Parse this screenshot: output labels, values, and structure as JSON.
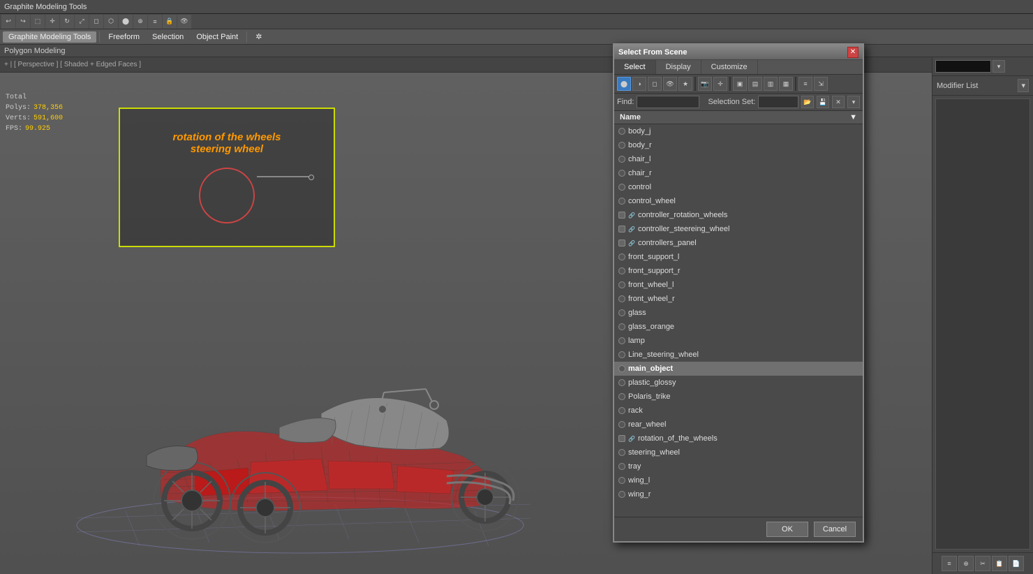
{
  "app": {
    "title": "Graphite Modeling Tools",
    "menu_items": [
      "Freeform",
      "Selection",
      "Object Paint",
      ""
    ],
    "sub_bar": "Polygon Modeling"
  },
  "viewport": {
    "label": "+ | [ Perspective ] [ Shaded + Edged Faces ]",
    "stats": {
      "polys_label": "Polys:",
      "polys_value": "378,356",
      "verts_label": "Verts:",
      "verts_value": "591,600",
      "fps_label": "FPS:",
      "fps_value": "99.925",
      "total_label": "Total"
    },
    "anim_text1": "rotation of the wheels",
    "anim_text2": "steering wheel"
  },
  "right_panel": {
    "modifier_label": "Modifier List",
    "buttons": [
      "≡",
      "🔗",
      "✂",
      "📋",
      "📄"
    ]
  },
  "dialog": {
    "title": "Select From Scene",
    "close": "✕",
    "tabs": [
      "Select",
      "Display",
      "Customize"
    ],
    "active_tab": "Select",
    "find_label": "Find:",
    "find_placeholder": "",
    "sel_set_label": "Selection Set:",
    "name_column": "Name",
    "objects": [
      {
        "name": "body_j",
        "type": "mesh",
        "selected": false
      },
      {
        "name": "body_r",
        "type": "mesh",
        "selected": false
      },
      {
        "name": "chair_l",
        "type": "mesh",
        "selected": false
      },
      {
        "name": "chair_r",
        "type": "mesh",
        "selected": false
      },
      {
        "name": "control",
        "type": "mesh",
        "selected": false
      },
      {
        "name": "control_wheel",
        "type": "mesh",
        "selected": false
      },
      {
        "name": "controller_rotation_wheels",
        "type": "linked",
        "selected": false
      },
      {
        "name": "controller_steereing_wheel",
        "type": "linked",
        "selected": false
      },
      {
        "name": "controllers_panel",
        "type": "linked",
        "selected": false
      },
      {
        "name": "front_support_l",
        "type": "mesh",
        "selected": false
      },
      {
        "name": "front_support_r",
        "type": "mesh",
        "selected": false
      },
      {
        "name": "front_wheel_l",
        "type": "mesh",
        "selected": false
      },
      {
        "name": "front_wheel_r",
        "type": "mesh",
        "selected": false
      },
      {
        "name": "glass",
        "type": "mesh",
        "selected": false
      },
      {
        "name": "glass_orange",
        "type": "mesh",
        "selected": false
      },
      {
        "name": "lamp",
        "type": "mesh",
        "selected": false
      },
      {
        "name": "Line_steering_wheel",
        "type": "mesh",
        "selected": false
      },
      {
        "name": "main_object",
        "type": "mesh",
        "selected": true
      },
      {
        "name": "plastic_glossy",
        "type": "mesh",
        "selected": false
      },
      {
        "name": "Polaris_trike",
        "type": "mesh",
        "selected": false
      },
      {
        "name": "rack",
        "type": "mesh",
        "selected": false
      },
      {
        "name": "rear_wheel",
        "type": "mesh",
        "selected": false
      },
      {
        "name": "rotation_of_the_wheels",
        "type": "linked",
        "selected": false
      },
      {
        "name": "steering_wheel",
        "type": "mesh",
        "selected": false
      },
      {
        "name": "tray",
        "type": "mesh",
        "selected": false
      },
      {
        "name": "wing_l",
        "type": "mesh",
        "selected": false
      },
      {
        "name": "wing_r",
        "type": "mesh",
        "selected": false
      }
    ],
    "ok_label": "OK",
    "cancel_label": "Cancel"
  }
}
